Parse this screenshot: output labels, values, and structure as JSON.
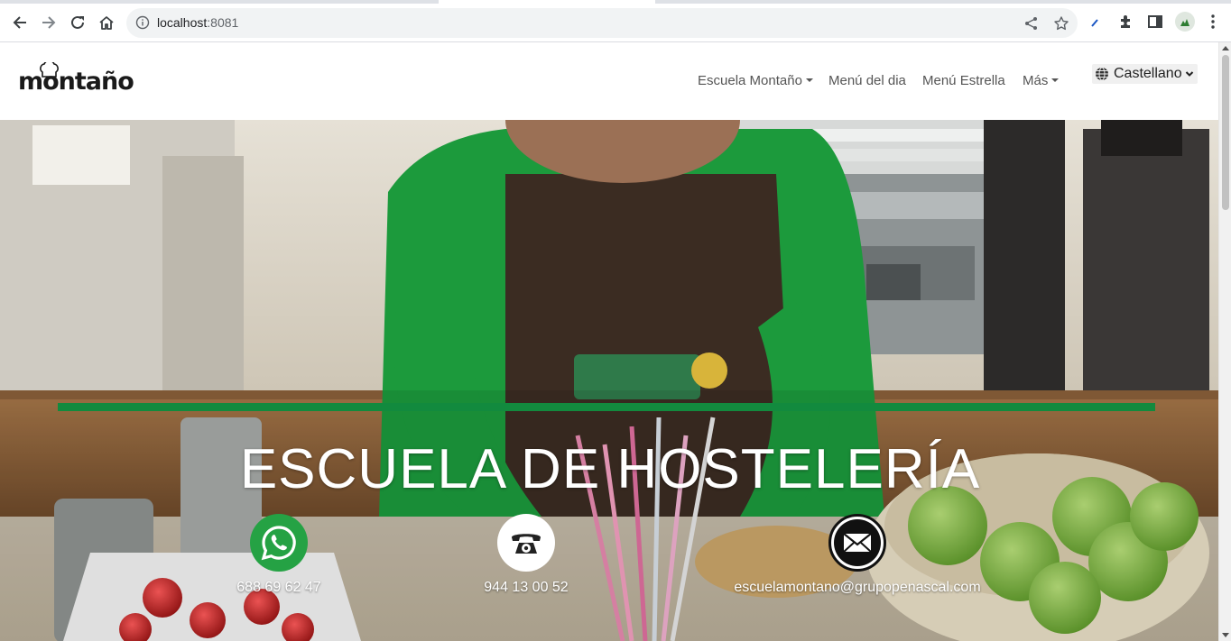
{
  "browser": {
    "url_host": "localhost",
    "url_port": ":8081"
  },
  "site": {
    "logo_text": "montaño",
    "nav": [
      {
        "label": "Escuela Montaño",
        "dropdown": true
      },
      {
        "label": "Menú del dia",
        "dropdown": false
      },
      {
        "label": "Menú Estrella",
        "dropdown": false
      },
      {
        "label": "Más",
        "dropdown": true
      }
    ],
    "language": {
      "selected": "Castellano",
      "icon": "globe-icon"
    }
  },
  "hero": {
    "title": "ESCUELA DE HOSTELERÍA",
    "accent_color": "#128a3e",
    "contacts": [
      {
        "icon": "whatsapp-icon",
        "label": "688 69 62 47",
        "color": "#25a244"
      },
      {
        "icon": "phone-icon",
        "label": "944 13 00 52",
        "color": "#ffffff"
      },
      {
        "icon": "email-icon",
        "label": "escuelamontano@grupopenascal.com",
        "color": "#ffffff"
      }
    ]
  }
}
